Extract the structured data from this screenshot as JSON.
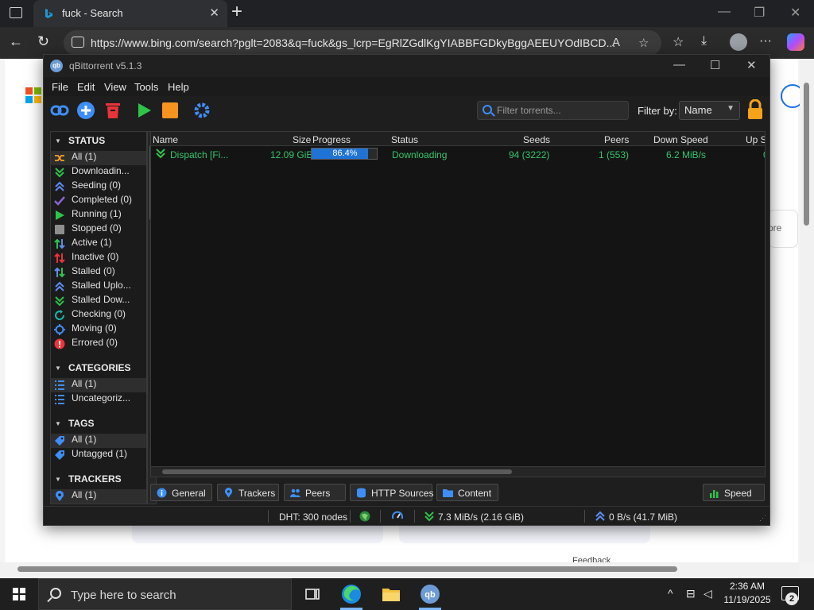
{
  "browser": {
    "tab_title": "fuck - Search",
    "url": "https://www.bing.com/search?pglt=2083&q=fuck&gs_lcrp=EgRlZGdlKgYIABBFGDkyBggAEEUYOdIBCD..."
  },
  "bing": {
    "more_text": "ore",
    "feedback": "Feedback"
  },
  "qb": {
    "title": "qBittorrent v5.1.3",
    "menu": [
      "File",
      "Edit",
      "View",
      "Tools",
      "Help"
    ],
    "filter_placeholder": "Filter torrents...",
    "filter_by_label": "Filter by:",
    "filter_by_value": "Name",
    "sidebar": {
      "status_header": "STATUS",
      "status_items": [
        "All (1)",
        "Downloadin...",
        "Seeding (0)",
        "Completed (0)",
        "Running (1)",
        "Stopped (0)",
        "Active (1)",
        "Inactive (0)",
        "Stalled (0)",
        "Stalled Uplo...",
        "Stalled Dow...",
        "Checking (0)",
        "Moving (0)",
        "Errored (0)"
      ],
      "categories_header": "CATEGORIES",
      "category_items": [
        "All (1)",
        "Uncategoriz..."
      ],
      "tags_header": "TAGS",
      "tag_items": [
        "All (1)",
        "Untagged (1)"
      ],
      "trackers_header": "TRACKERS",
      "tracker_items": [
        "All (1)"
      ]
    },
    "columns": [
      "Name",
      "Size",
      "Progress",
      "Status",
      "Seeds",
      "Peers",
      "Down Speed",
      "Up S"
    ],
    "torrent": {
      "name": "Dispatch [Fi...",
      "size": "12.09 GiB",
      "progress": 86.4,
      "progress_text": "86.4%",
      "status": "Downloading",
      "seeds": "94 (3222)",
      "peers": "1 (553)",
      "down_speed": "6.2 MiB/s",
      "up_speed": "0"
    },
    "panel_tabs": [
      "General",
      "Trackers",
      "Peers",
      "HTTP Sources",
      "Content"
    ],
    "speed_tab": "Speed",
    "statusbar": {
      "dht": "DHT: 300 nodes",
      "download": "7.3 MiB/s (2.16 GiB)",
      "upload": "0 B/s (41.7 MiB)"
    }
  },
  "taskbar": {
    "search_placeholder": "Type here to search",
    "time": "2:36 AM",
    "date": "11/19/2025",
    "notifications": "2"
  },
  "colors": {
    "accent_blue": "#1f73d6",
    "downloading_green": "#34c56a",
    "qb_background": "#1e1e1e"
  }
}
